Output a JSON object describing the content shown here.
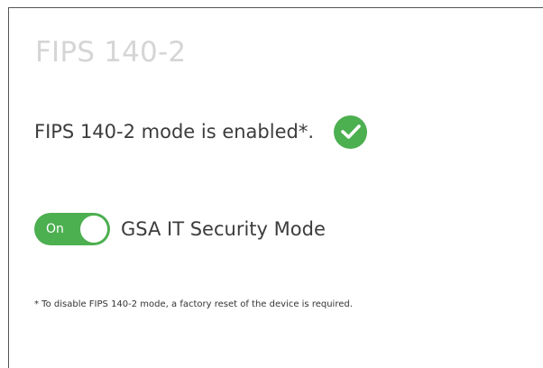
{
  "panel": {
    "title": "FIPS 140-2",
    "status_text": "FIPS 140-2 mode is enabled*.",
    "status_icon": "check-circle-icon",
    "accent_color": "#4caf50",
    "toggle": {
      "state_label": "On",
      "label": "GSA IT Security Mode",
      "enabled": true
    },
    "footnote": "* To disable FIPS 140-2 mode, a factory reset of the device is required."
  }
}
